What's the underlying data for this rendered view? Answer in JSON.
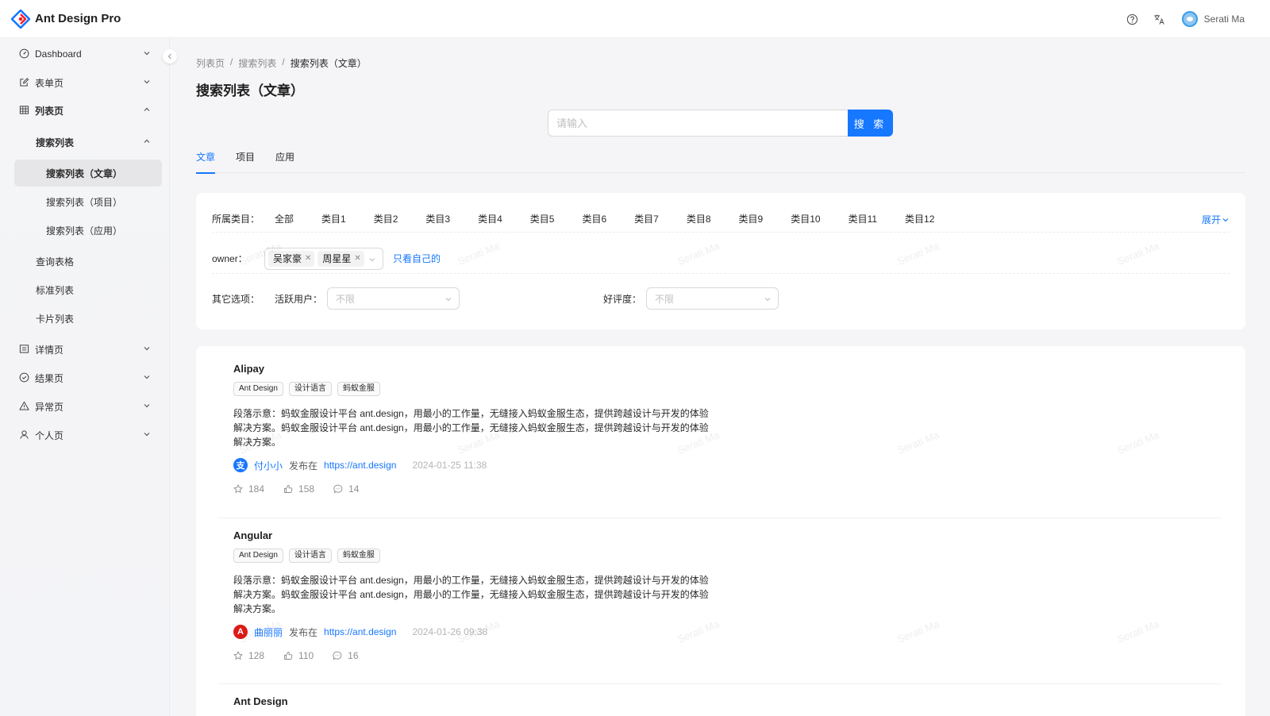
{
  "app": {
    "logo_text": "Ant Design Pro",
    "accent": "#1677ff"
  },
  "header": {
    "user_name": "Serati Ma"
  },
  "sidebar": {
    "items": [
      {
        "label": "Dashboard"
      },
      {
        "label": "表单页"
      },
      {
        "label": "列表页"
      },
      {
        "label": "搜索列表"
      },
      {
        "label": "搜索列表（文章）"
      },
      {
        "label": "搜索列表（项目）"
      },
      {
        "label": "搜索列表（应用）"
      },
      {
        "label": "查询表格"
      },
      {
        "label": "标准列表"
      },
      {
        "label": "卡片列表"
      },
      {
        "label": "详情页"
      },
      {
        "label": "结果页"
      },
      {
        "label": "异常页"
      },
      {
        "label": "个人页"
      }
    ]
  },
  "breadcrumb": [
    "列表页",
    "搜索列表",
    "搜索列表（文章）"
  ],
  "page_title": "搜索列表（文章）",
  "search": {
    "placeholder": "请输入",
    "button": "搜 索"
  },
  "tabs": [
    "文章",
    "项目",
    "应用"
  ],
  "filters": {
    "category_label": "所属类目：",
    "categories": [
      "全部",
      "类目1",
      "类目2",
      "类目3",
      "类目4",
      "类目5",
      "类目6",
      "类目7",
      "类目8",
      "类目9",
      "类目10",
      "类目11",
      "类目12"
    ],
    "expand": "展开",
    "owner_label": "owner：",
    "owners_selected": [
      "吴家豪",
      "周星星"
    ],
    "only_mine": "只看自己的",
    "other_label": "其它选项：",
    "active_user_label": "活跃用户：",
    "active_user_placeholder": "不限",
    "rating_label": "好评度：",
    "rating_placeholder": "不限"
  },
  "articles": [
    {
      "title": "Alipay",
      "tags": [
        "Ant Design",
        "设计语言",
        "蚂蚁金服"
      ],
      "desc": "段落示意：蚂蚁金服设计平台 ant.design，用最小的工作量，无缝接入蚂蚁金服生态，提供跨越设计与开发的体验解决方案。蚂蚁金服设计平台 ant.design，用最小的工作量，无缝接入蚂蚁金服生态，提供跨越设计与开发的体验解决方案。",
      "avatar_glyph": "支",
      "avatar_color": "#1677ff",
      "owner": "付小小",
      "published_at_label": "发布在",
      "href": "https://ant.design",
      "time": "2024-01-25 11:38",
      "star": "184",
      "like": "158",
      "message": "14"
    },
    {
      "title": "Angular",
      "tags": [
        "Ant Design",
        "设计语言",
        "蚂蚁金服"
      ],
      "desc": "段落示意：蚂蚁金服设计平台 ant.design，用最小的工作量，无缝接入蚂蚁金服生态，提供跨越设计与开发的体验解决方案。蚂蚁金服设计平台 ant.design，用最小的工作量，无缝接入蚂蚁金服生态，提供跨越设计与开发的体验解决方案。",
      "avatar_glyph": "A",
      "avatar_color": "#dd1b16",
      "owner": "曲丽丽",
      "published_at_label": "发布在",
      "href": "https://ant.design",
      "time": "2024-01-26 09:38",
      "star": "128",
      "like": "110",
      "message": "16"
    },
    {
      "title": "Ant Design"
    }
  ],
  "watermark": "Serati Ma"
}
